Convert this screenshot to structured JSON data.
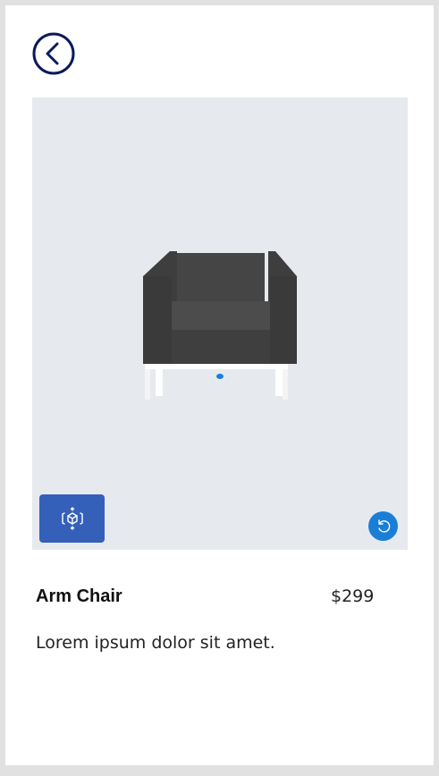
{
  "header": {
    "back_icon": "chevron-left-circle-icon",
    "accent_color": "#0b1a5c"
  },
  "viewer": {
    "background_color": "#e6eaef",
    "model": "arm-chair",
    "ar_button_icon": "ar-cube-icon",
    "ar_button_color": "#3460b9",
    "reset_button_icon": "reset-rotate-icon",
    "reset_button_color": "#1a7ed6"
  },
  "product": {
    "name": "Arm Chair",
    "price": "$299",
    "description": "Lorem ipsum dolor sit amet."
  }
}
